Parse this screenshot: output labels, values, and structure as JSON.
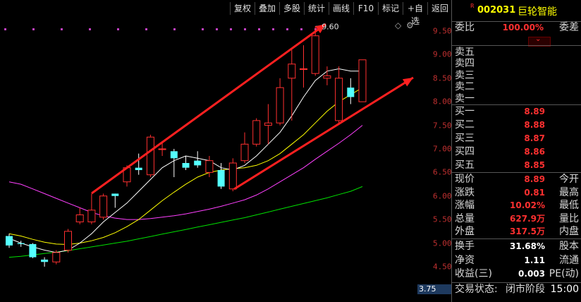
{
  "toolbar": {
    "buttons": [
      "复权",
      "叠加",
      "多股",
      "统计",
      "画线",
      "F10",
      "标记",
      "+自选",
      "返回"
    ]
  },
  "stock": {
    "code": "002031",
    "name": "巨轮智能",
    "mark": "R"
  },
  "chart_data": {
    "type": "candlestick",
    "ylim": [
      3.75,
      9.8
    ],
    "yticks": [
      "9.50",
      "9.00",
      "8.50",
      "8.00",
      "7.50",
      "7.00",
      "6.50",
      "6.00",
      "5.50",
      "5.00",
      "4.50",
      "4.00"
    ],
    "yticks_values": [
      9.5,
      9.0,
      8.5,
      8.0,
      7.5,
      7.0,
      6.5,
      6.0,
      5.5,
      5.0,
      4.5,
      4.0
    ],
    "current_value_label": "3.75",
    "high_annotation": "9.60",
    "candles": [
      {
        "o": 5.15,
        "c": 4.95,
        "h": 5.2,
        "l": 4.9
      },
      {
        "o": 5.0,
        "c": 4.98,
        "h": 5.05,
        "l": 4.92
      },
      {
        "o": 4.98,
        "c": 4.7,
        "h": 5.0,
        "l": 4.68
      },
      {
        "o": 4.65,
        "c": 4.6,
        "h": 4.7,
        "l": 4.5
      },
      {
        "o": 4.6,
        "c": 4.8,
        "h": 4.85,
        "l": 4.55
      },
      {
        "o": 4.85,
        "c": 5.25,
        "h": 5.3,
        "l": 4.8
      },
      {
        "o": 5.45,
        "c": 5.6,
        "h": 5.75,
        "l": 5.4
      },
      {
        "o": 5.45,
        "c": 5.7,
        "h": 6.05,
        "l": 5.4
      },
      {
        "o": 5.55,
        "c": 6.0,
        "h": 6.05,
        "l": 5.5
      },
      {
        "o": 6.05,
        "c": 6.0,
        "h": 6.05,
        "l": 5.75
      },
      {
        "o": 6.3,
        "c": 6.6,
        "h": 6.65,
        "l": 6.2
      },
      {
        "o": 6.6,
        "c": 6.55,
        "h": 6.9,
        "l": 6.45
      },
      {
        "o": 6.45,
        "c": 7.25,
        "h": 7.3,
        "l": 6.4
      },
      {
        "o": 7.0,
        "c": 7.0,
        "h": 7.15,
        "l": 6.85
      },
      {
        "o": 6.95,
        "c": 6.8,
        "h": 7.0,
        "l": 6.4
      },
      {
        "o": 6.7,
        "c": 6.6,
        "h": 6.85,
        "l": 6.55
      },
      {
        "o": 6.75,
        "c": 6.65,
        "h": 6.95,
        "l": 6.6
      },
      {
        "o": 6.5,
        "c": 6.75,
        "h": 6.85,
        "l": 6.4
      },
      {
        "o": 6.55,
        "c": 6.2,
        "h": 6.7,
        "l": 6.15
      },
      {
        "o": 6.15,
        "c": 6.7,
        "h": 6.8,
        "l": 6.1
      },
      {
        "o": 6.75,
        "c": 7.1,
        "h": 7.35,
        "l": 6.7
      },
      {
        "o": 7.1,
        "c": 7.6,
        "h": 7.65,
        "l": 7.05
      },
      {
        "o": 7.5,
        "c": 7.55,
        "h": 7.95,
        "l": 7.1
      },
      {
        "o": 7.55,
        "c": 8.3,
        "h": 8.5,
        "l": 7.5
      },
      {
        "o": 8.5,
        "c": 8.8,
        "h": 9.1,
        "l": 7.6
      },
      {
        "o": 8.7,
        "c": 8.7,
        "h": 9.2,
        "l": 8.3
      },
      {
        "o": 8.6,
        "c": 9.4,
        "h": 9.6,
        "l": 8.55
      },
      {
        "o": 8.5,
        "c": 8.55,
        "h": 8.75,
        "l": 8.35
      },
      {
        "o": 7.6,
        "c": 8.5,
        "h": 8.75,
        "l": 7.55
      },
      {
        "o": 8.3,
        "c": 8.1,
        "h": 8.5,
        "l": 7.95
      },
      {
        "o": 8.0,
        "c": 8.89,
        "h": 8.89,
        "l": 8.0
      }
    ],
    "ma5": [
      5.1,
      5.0,
      4.92,
      4.85,
      4.8,
      4.85,
      5.0,
      5.2,
      5.45,
      5.65,
      5.85,
      6.1,
      6.35,
      6.6,
      6.75,
      6.85,
      6.8,
      6.75,
      6.6,
      6.55,
      6.65,
      6.85,
      7.1,
      7.35,
      7.7,
      8.1,
      8.45,
      8.65,
      8.7,
      8.65,
      8.65
    ],
    "ma10": [
      5.2,
      5.15,
      5.08,
      5.02,
      4.98,
      4.97,
      5.0,
      5.05,
      5.12,
      5.22,
      5.35,
      5.5,
      5.7,
      5.9,
      6.08,
      6.25,
      6.4,
      6.5,
      6.55,
      6.58,
      6.6,
      6.65,
      6.75,
      6.9,
      7.1,
      7.3,
      7.55,
      7.8,
      8.0,
      8.15,
      8.3
    ],
    "ma20": [
      6.3,
      6.25,
      6.15,
      6.05,
      5.95,
      5.85,
      5.75,
      5.65,
      5.58,
      5.53,
      5.5,
      5.5,
      5.52,
      5.55,
      5.58,
      5.62,
      5.67,
      5.72,
      5.78,
      5.85,
      5.92,
      6.02,
      6.15,
      6.3,
      6.45,
      6.6,
      6.78,
      6.95,
      7.12,
      7.3,
      7.5
    ],
    "ma60": [
      4.7,
      4.72,
      4.75,
      4.78,
      4.81,
      4.84,
      4.88,
      4.92,
      4.96,
      5.0,
      5.04,
      5.09,
      5.14,
      5.19,
      5.24,
      5.29,
      5.34,
      5.39,
      5.44,
      5.49,
      5.54,
      5.6,
      5.66,
      5.72,
      5.78,
      5.84,
      5.9,
      5.96,
      6.03,
      6.1,
      6.2
    ]
  },
  "panel": {
    "weibi": {
      "label": "委比",
      "value": "100.00%",
      "label2": "委差"
    },
    "asks": [
      {
        "label": "卖五",
        "price": ""
      },
      {
        "label": "卖四",
        "price": ""
      },
      {
        "label": "卖三",
        "price": ""
      },
      {
        "label": "卖二",
        "price": ""
      },
      {
        "label": "卖一",
        "price": ""
      }
    ],
    "bids": [
      {
        "label": "买一",
        "price": "8.89"
      },
      {
        "label": "买二",
        "price": "8.88"
      },
      {
        "label": "买三",
        "price": "8.87"
      },
      {
        "label": "买四",
        "price": "8.86"
      },
      {
        "label": "买五",
        "price": "8.85"
      }
    ],
    "stats": [
      {
        "label": "现价",
        "value": "8.89",
        "label2": "今开"
      },
      {
        "label": "涨跌",
        "value": "0.81",
        "label2": "最高"
      },
      {
        "label": "涨幅",
        "value": "10.02%",
        "label2": "最低"
      },
      {
        "label": "总量",
        "value": "627.9万",
        "label2": "量比"
      },
      {
        "label": "外盘",
        "value": "317.5万",
        "label2": "内盘"
      }
    ],
    "stats2": [
      {
        "label": "换手",
        "value": "31.68%",
        "label2": "股本"
      },
      {
        "label": "净资",
        "value": "1.11",
        "label2": "流通"
      },
      {
        "label": "收益(三)",
        "value": "0.003",
        "label2": "PE(动)"
      }
    ],
    "status": {
      "label": "交易状态:",
      "value": "闭市阶段",
      "time": "15:00"
    }
  },
  "colors": {
    "up": "#ff3030",
    "down": "#54ffff",
    "ma5": "#ffffff",
    "ma10": "#ffff00",
    "ma20": "#ff40ff",
    "ma60": "#00e000",
    "arrow": "#ff2020"
  }
}
